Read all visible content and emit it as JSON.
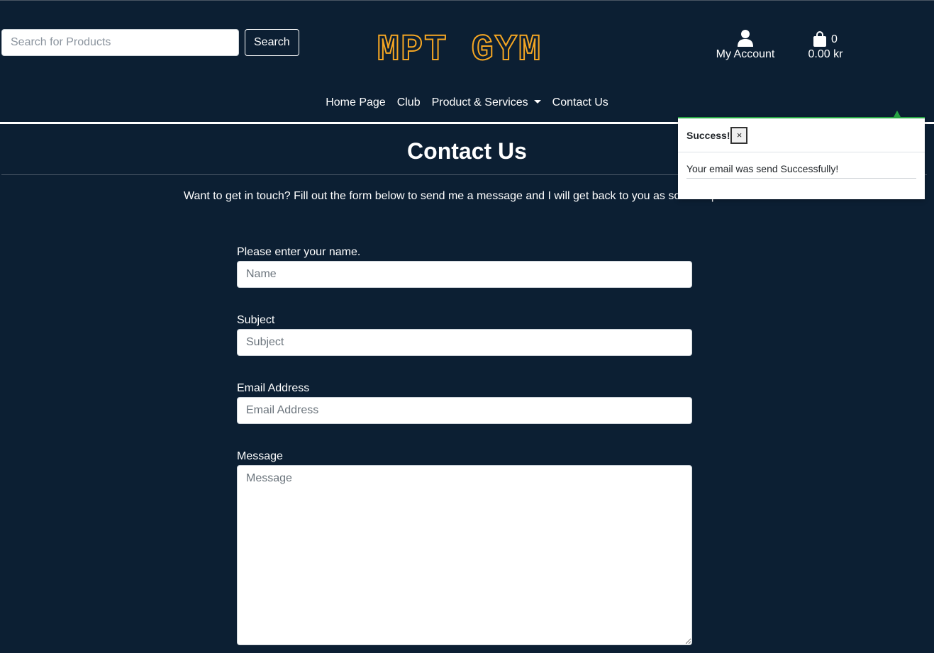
{
  "colors": {
    "background": "#0c1f33",
    "logo_stroke": "#f5a623",
    "toast_accent": "#28a745",
    "text": "#ffffff"
  },
  "header": {
    "search": {
      "placeholder": "Search for Products",
      "value": "",
      "button_label": "Search"
    },
    "logo_text": "MPT GYM",
    "account": {
      "icon": "user-icon",
      "label": "My Account"
    },
    "cart": {
      "icon": "shopping-bag-icon",
      "count": "0",
      "total": "0.00 kr"
    }
  },
  "nav": {
    "items": [
      {
        "label": "Home Page"
      },
      {
        "label": "Club"
      },
      {
        "label": "Product & Services",
        "dropdown": true
      },
      {
        "label": "Contact Us"
      }
    ]
  },
  "main": {
    "title": "Contact Us",
    "intro": "Want to get in touch? Fill out the form below to send me a message and I will get back to you as soon as possible.",
    "form": {
      "name": {
        "label": "Please enter your name.",
        "placeholder": "Name"
      },
      "subject": {
        "label": "Subject",
        "placeholder": "Subject"
      },
      "email": {
        "label": "Email Address",
        "placeholder": "Email Address"
      },
      "message": {
        "label": "Message",
        "placeholder": "Message"
      }
    }
  },
  "toast": {
    "title": "Success!",
    "close_label": "×",
    "message": "Your email was send Successfully!"
  }
}
